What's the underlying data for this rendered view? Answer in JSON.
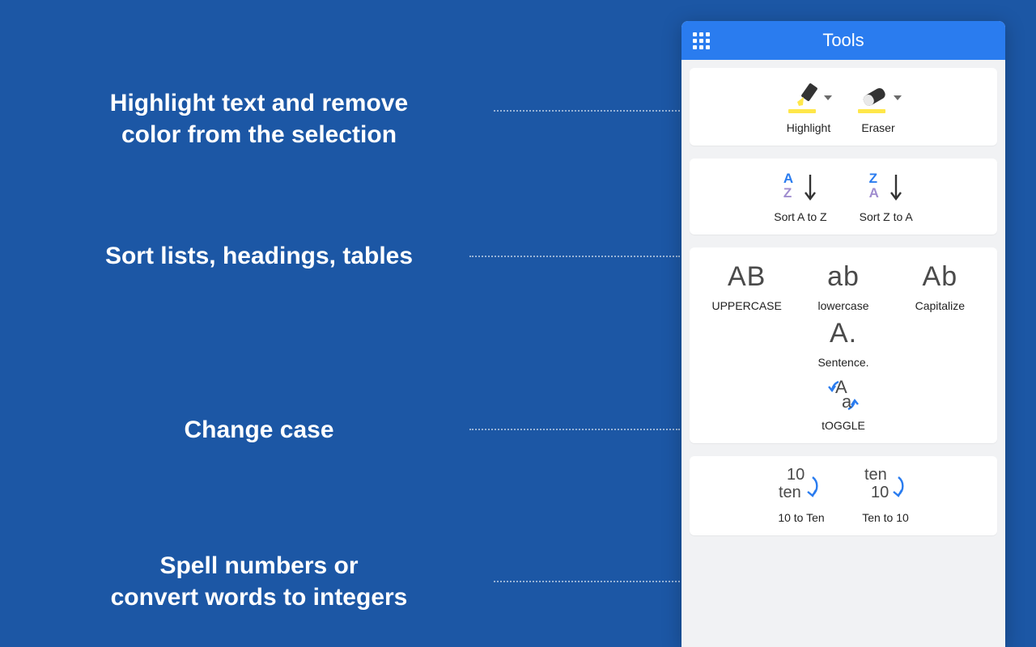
{
  "features": {
    "f1_line1": "Highlight text and remove",
    "f1_line2": "color from the selection",
    "f2": "Sort lists, headings, tables",
    "f3": "Change case",
    "f4_line1": "Spell numbers or",
    "f4_line2": "convert words to integers"
  },
  "panel": {
    "title": "Tools",
    "highlight": {
      "highlight_label": "Highlight",
      "eraser_label": "Eraser"
    },
    "sort": {
      "az_label": "Sort A to Z",
      "za_label": "Sort Z to A"
    },
    "case": {
      "upper_glyph": "AB",
      "upper_label": "UPPERCASE",
      "lower_glyph": "ab",
      "lower_label": "lowercase",
      "cap_glyph": "Ab",
      "cap_label": "Capitalize",
      "sent_glyph": "A.",
      "sent_label": "Sentence.",
      "toggle_label": "tOGGLE"
    },
    "numbers": {
      "to_ten_top": "10",
      "to_ten_bot": "ten",
      "to_ten_label": "10 to Ten",
      "to_10_top": "ten",
      "to_10_bot": "10",
      "to_10_label": "Ten to 10"
    }
  }
}
